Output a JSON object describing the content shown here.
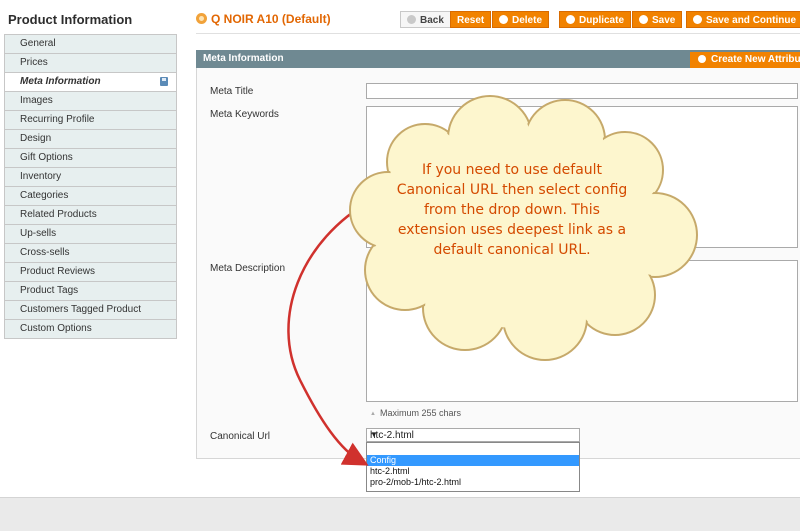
{
  "sidebar": {
    "title": "Product Information",
    "items": [
      {
        "label": "General"
      },
      {
        "label": "Prices"
      },
      {
        "label": "Meta Information"
      },
      {
        "label": "Images"
      },
      {
        "label": "Recurring Profile"
      },
      {
        "label": "Design"
      },
      {
        "label": "Gift Options"
      },
      {
        "label": "Inventory"
      },
      {
        "label": "Categories"
      },
      {
        "label": "Related Products"
      },
      {
        "label": "Up-sells"
      },
      {
        "label": "Cross-sells"
      },
      {
        "label": "Product Reviews"
      },
      {
        "label": "Product Tags"
      },
      {
        "label": "Customers Tagged Product"
      },
      {
        "label": "Custom Options"
      }
    ],
    "active_index": 2
  },
  "header": {
    "product_title": "Q NOIR A10 (Default)",
    "buttons": {
      "back": "Back",
      "reset": "Reset",
      "delete": "Delete",
      "duplicate": "Duplicate",
      "save": "Save",
      "save_continue": "Save and Continue"
    }
  },
  "fieldset": {
    "title": "Meta Information",
    "create_button": "Create New Attribute",
    "meta_title_label": "Meta Title",
    "meta_title_value": "",
    "meta_keywords_label": "Meta Keywords",
    "meta_description_label": "Meta Description",
    "max_chars_hint": "Maximum 255 chars",
    "canonical_label": "Canonical Url",
    "canonical_value": "htc-2.html",
    "canonical_options": [
      "",
      "Config",
      "htc-2.html",
      "pro-2/mob-1/htc-2.html"
    ],
    "canonical_highlighted": "Config"
  },
  "callout": {
    "text": "If you need to use default Canonical URL then select config from the drop down. This extension uses deepest link as a default canonical URL.",
    "color": "#d44a00"
  },
  "colors": {
    "accent_orange": "#f18200",
    "panel_header": "#6f8992",
    "sidebar_bg": "#e7efef",
    "title_orange": "#e26703"
  }
}
